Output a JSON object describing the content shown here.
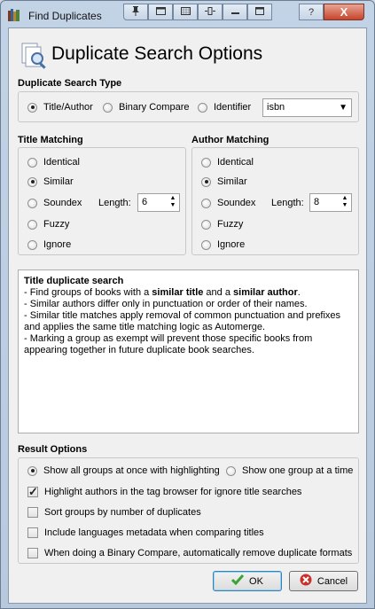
{
  "window": {
    "title": "Find Duplicates"
  },
  "titlebar": {
    "close_label": "X",
    "help_label": "?"
  },
  "dialog": {
    "title": "Duplicate Search Options"
  },
  "search_type": {
    "label": "Duplicate Search Type",
    "options": [
      "Title/Author",
      "Binary Compare",
      "Identifier"
    ],
    "selected": "Title/Author",
    "identifier_value": "isbn"
  },
  "title_matching": {
    "label": "Title Matching",
    "options": [
      "Identical",
      "Similar",
      "Soundex",
      "Fuzzy",
      "Ignore"
    ],
    "selected": "Similar",
    "length_label": "Length:",
    "length_value": "6"
  },
  "author_matching": {
    "label": "Author Matching",
    "options": [
      "Identical",
      "Similar",
      "Soundex",
      "Fuzzy",
      "Ignore"
    ],
    "selected": "Similar",
    "length_label": "Length:",
    "length_value": "8"
  },
  "description": {
    "heading": "Title duplicate search",
    "line1_a": "- Find groups of books with a ",
    "line1_b": "similar title",
    "line1_c": " and a ",
    "line1_d": "similar author",
    "line1_e": ".",
    "line2": "- Similar authors differ only in punctuation or order of their names.",
    "line3": "- Similar title matches apply removal of common punctuation and prefixes and applies the same title matching logic as Automerge.",
    "line4": "- Marking a group as exempt will prevent those specific books from appearing together in future duplicate book searches."
  },
  "result_options": {
    "label": "Result Options",
    "show_all": "Show all groups at once with highlighting",
    "show_one": "Show one group at a time",
    "selected": "show_all",
    "checks": [
      {
        "label": "Highlight authors in the tag browser for ignore title searches",
        "checked": true
      },
      {
        "label": "Sort groups by number of duplicates",
        "checked": false
      },
      {
        "label": "Include languages metadata when comparing titles",
        "checked": false
      },
      {
        "label": "When doing a Binary Compare, automatically remove duplicate formats",
        "checked": false
      }
    ]
  },
  "buttons": {
    "ok": "OK",
    "cancel": "Cancel"
  },
  "colors": {
    "ok_check": "#3aa335",
    "cancel_icon": "#c9302c",
    "accent": "#3c7fb1"
  }
}
